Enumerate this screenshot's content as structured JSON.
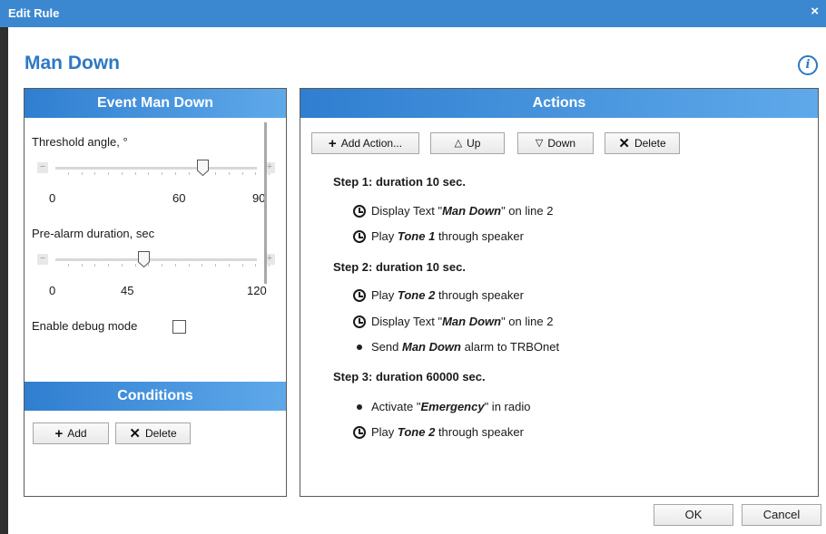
{
  "window": {
    "title": "Edit Rule",
    "close_glyph": "×"
  },
  "rule": {
    "name": "Man Down",
    "info_glyph": "i"
  },
  "event_panel": {
    "title": "Event  Man Down",
    "threshold": {
      "label": "Threshold angle, °",
      "min_label": "0",
      "mid_label": "60",
      "max_label": "90",
      "min": 0,
      "max": 90,
      "value": 60
    },
    "prealarm": {
      "label": "Pre-alarm duration, sec",
      "min_label": "0",
      "mid_label": "45",
      "max_label": "120",
      "min": 0,
      "max": 120,
      "value": 45
    },
    "debug": {
      "label": "Enable debug mode",
      "checked": false
    }
  },
  "conditions_panel": {
    "title": "Conditions",
    "add_label": "Add",
    "delete_label": "Delete"
  },
  "actions_panel": {
    "title": "Actions",
    "toolbar": {
      "add_label": "Add Action...",
      "up_label": "Up",
      "down_label": "Down",
      "delete_label": "Delete"
    },
    "steps": [
      {
        "label": "Step 1:  duration 10 sec."
      },
      {
        "label": "Step 2:  duration 10 sec."
      },
      {
        "label": "Step 3:  duration 60000 sec."
      }
    ],
    "items": {
      "s1a": {
        "pre": "Display Text \"",
        "em": "Man Down",
        "post": "\" on line 2"
      },
      "s1b": {
        "pre": "Play ",
        "em": "Tone 1",
        "post": " through speaker"
      },
      "s2a": {
        "pre": "Play ",
        "em": "Tone 2",
        "post": " through speaker"
      },
      "s2b": {
        "pre": "Display Text \"",
        "em": "Man Down",
        "post": "\" on line 2"
      },
      "s2c": {
        "pre": "Send ",
        "em": "Man Down",
        "post": " alarm to TRBOnet"
      },
      "s3a": {
        "pre": "Activate \"",
        "em": "Emergency",
        "post": "\" in radio"
      },
      "s3b": {
        "pre": "Play ",
        "em": "Tone 2",
        "post": " through speaker"
      }
    }
  },
  "footer": {
    "ok_label": "OK",
    "cancel_label": "Cancel"
  },
  "colors": {
    "titlebar": "#3c88d0",
    "heading": "#2d78c4",
    "panel_header_start": "#2f7ed0",
    "panel_header_end": "#5fa9ea"
  }
}
